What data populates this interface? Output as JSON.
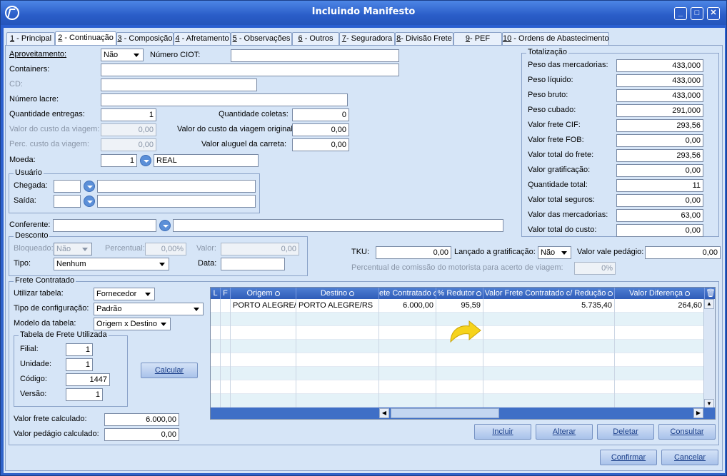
{
  "window": {
    "title": "Incluindo Manifesto",
    "min": "_",
    "max": "□",
    "close": "✕"
  },
  "tabs": [
    {
      "num": "1",
      "label": " - Principal"
    },
    {
      "num": "2",
      "label": " - Continuação"
    },
    {
      "num": "3",
      "label": " - Composição"
    },
    {
      "num": "4",
      "label": " - Afretamento"
    },
    {
      "num": "5",
      "label": " - Observações"
    },
    {
      "num": "6",
      "label": " - Outros"
    },
    {
      "num": "7",
      "label": "- Seguradora"
    },
    {
      "num": "8",
      "label": "- Divisão Frete"
    },
    {
      "num": "9",
      "label": "- PEF"
    },
    {
      "num": "10",
      "label": " - Ordens de Abastecimento"
    }
  ],
  "form": {
    "aproveitamento_label": "Aproveitamento:",
    "aproveitamento_value": "Não",
    "ciot_label": "Número CIOT:",
    "ciot_value": "",
    "containers_label": "Containers:",
    "cd_label": "CD:",
    "lacre_label": "Número lacre:",
    "qtd_entregas_label": "Quantidade entregas:",
    "qtd_entregas": "1",
    "qtd_coletas_label": "Quantidade coletas:",
    "qtd_coletas": "0",
    "custo_viagem_label": "Valor do custo da viagem:",
    "custo_viagem": "0,00",
    "custo_original_label": "Valor do custo da viagem original:",
    "custo_original": "0,00",
    "perc_custo_label": "Perc. custo da viagem:",
    "perc_custo": "0,00",
    "aluguel_label": "Valor aluguel da carreta:",
    "aluguel": "0,00",
    "moeda_label": "Moeda:",
    "moeda_code": "1",
    "moeda_name": "REAL"
  },
  "usuario": {
    "title": "Usuário",
    "chegada_label": "Chegada:",
    "saida_label": "Saída:"
  },
  "conferente_label": "Conferente:",
  "desconto": {
    "title": "Desconto",
    "bloqueado_label": "Bloqueado:",
    "bloqueado": "Não",
    "percentual_label": "Percentual:",
    "percentual": "0,00%",
    "valor_label": "Valor:",
    "valor": "0,00",
    "tipo_label": "Tipo:",
    "tipo": "Nenhum",
    "data_label": "Data:"
  },
  "totalizacao": {
    "title": "Totalização",
    "rows": [
      {
        "label": "Peso das mercadorias:",
        "value": "433,000"
      },
      {
        "label": "Peso líquido:",
        "value": "433,000"
      },
      {
        "label": "Peso bruto:",
        "value": "433,000"
      },
      {
        "label": "Peso cubado:",
        "value": "291,000"
      },
      {
        "label": "Valor frete CIF:",
        "value": "293,56"
      },
      {
        "label": "Valor frete FOB:",
        "value": "0,00"
      },
      {
        "label": "Valor total do frete:",
        "value": "293,56"
      },
      {
        "label": "Valor gratificação:",
        "value": "0,00"
      },
      {
        "label": "Quantidade total:",
        "value": "11"
      },
      {
        "label": "Valor total seguros:",
        "value": "0,00"
      },
      {
        "label": "Valor das mercadorias:",
        "value": "63,00"
      },
      {
        "label": "Valor total do custo:",
        "value": "0,00"
      }
    ]
  },
  "tku": {
    "label": "TKU:",
    "value": "0,00",
    "gratif_label": "Lançado a gratificação:",
    "gratif": "Não",
    "pedagio_label": "Valor vale pedágio:",
    "pedagio": "0,00",
    "comissao_label": "Percentual de comissão do motorista para acerto de viagem:",
    "comissao": "0%"
  },
  "frete": {
    "title": "Frete Contratado",
    "utilizar_label": "Utilizar tabela:",
    "utilizar": "Fornecedor",
    "tipo_conf_label": "Tipo de configuração:",
    "tipo_conf": "Padrão",
    "modelo_label": "Modelo da tabela:",
    "modelo": "Origem x Destino",
    "tabela_title": "Tabela de Frete Utilizada",
    "filial_label": "Filial:",
    "filial": "1",
    "unidade_label": "Unidade:",
    "unidade": "1",
    "codigo_label": "Código:",
    "codigo": "1447",
    "versao_label": "Versão:",
    "versao": "1",
    "calcular": "Calcular",
    "valor_calc_label": "Valor frete calculado:",
    "valor_calc": "6.000,00",
    "pedagio_calc_label": "Valor pedágio calculado:",
    "pedagio_calc": "0,00"
  },
  "grid": {
    "headers": [
      "L",
      "F",
      "Origem",
      "Destino",
      "ete Contratado",
      "% Redutor",
      "Valor Frete Contratado c/ Redução",
      "Valor Diferença"
    ],
    "rows": [
      {
        "origem": "PORTO ALEGRE/",
        "destino": "PORTO ALEGRE/RS",
        "contratado": "6.000,00",
        "redutor": "95,59",
        "reducao": "5.735,40",
        "diferenca": "264,60"
      }
    ]
  },
  "actions": {
    "incluir": "Incluir",
    "alterar": "Alterar",
    "deletar": "Deletar",
    "consultar": "Consultar",
    "confirmar": "Confirmar",
    "cancelar": "Cancelar"
  }
}
